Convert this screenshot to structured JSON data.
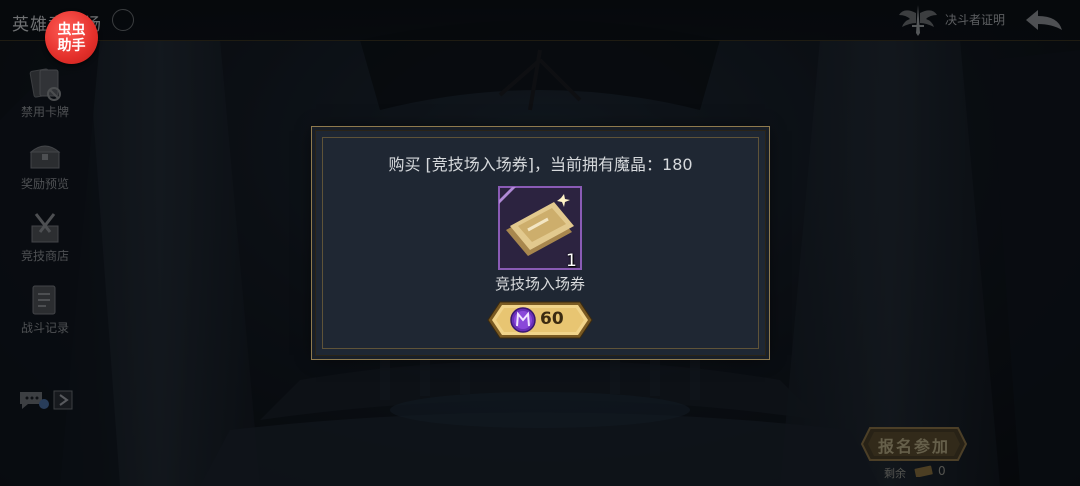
{
  "header": {
    "title": "英雄竞技场",
    "title_badge": "",
    "assist_badge": "虫虫助手",
    "cert_label": "决斗者证明",
    "back_icon": "back-arrow-icon",
    "cert_icon": "winged-sword-emblem-icon"
  },
  "sidebar": {
    "items": [
      {
        "label": "禁用卡牌",
        "icon": "banned-cards-icon"
      },
      {
        "label": "奖励预览",
        "icon": "treasure-chest-icon"
      },
      {
        "label": "竞技商店",
        "icon": "shop-crate-icon"
      },
      {
        "label": "战斗记录",
        "icon": "battle-record-icon"
      }
    ],
    "chat_icon": "chat-icon"
  },
  "signup": {
    "label": "报名参加",
    "remaining_label": "剩余",
    "remaining_count": "0"
  },
  "dialog": {
    "message": "购买 [竞技场入场券]，当前拥有魔晶：180",
    "item_name": "竞技场入场券",
    "item_quantity": "1",
    "item_icon": "arena-ticket-icon",
    "price": "60",
    "currency_icon": "magic-crystal-icon"
  },
  "colors": {
    "gold": "#d9b26a",
    "purple_frame": "#8a5bb5",
    "badge_red": "#e4302b"
  }
}
